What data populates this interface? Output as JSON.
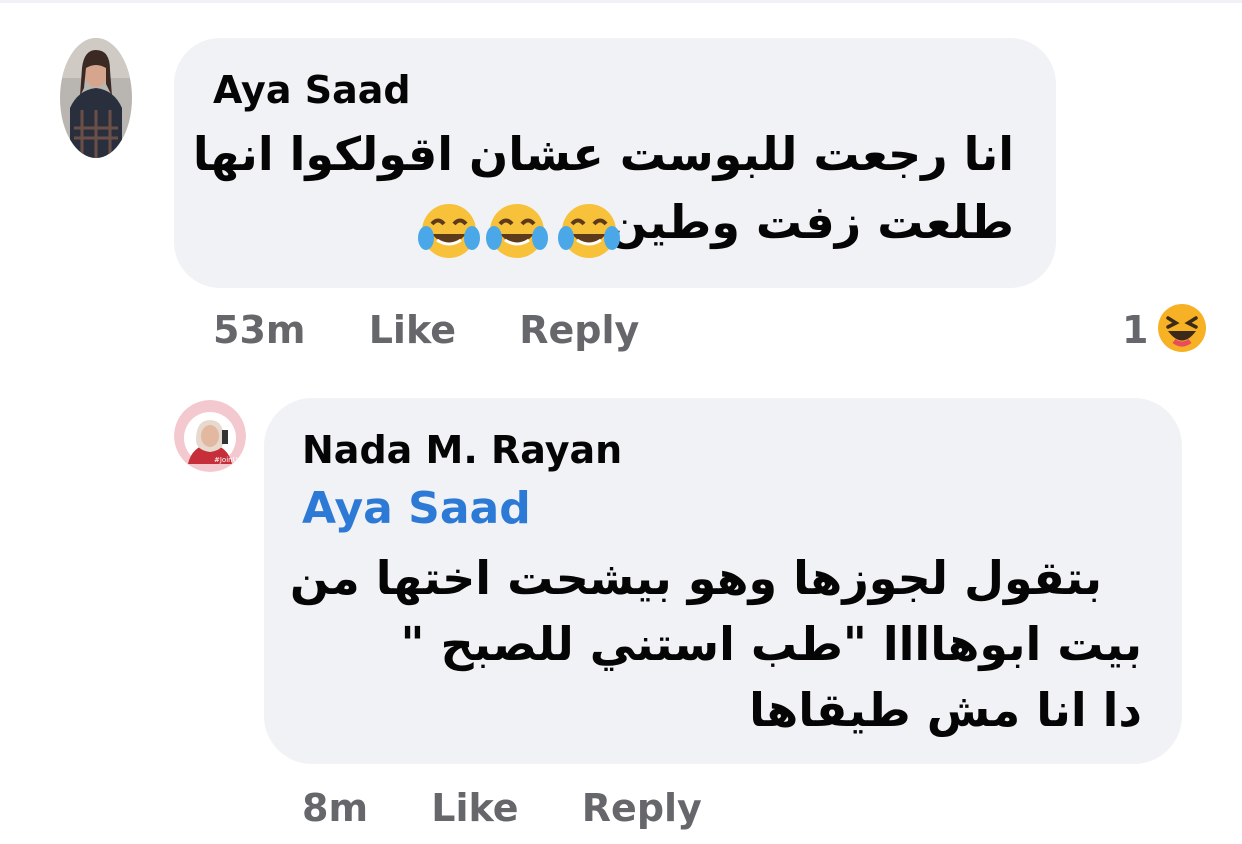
{
  "colors": {
    "bubble_bg": "#f0f2f5",
    "name_text": "#050505",
    "meta_text": "#65676b",
    "mention_link": "#2d7ad6",
    "haha_reaction": "#f7b125"
  },
  "comment": {
    "author": "Aya Saad",
    "text_lines": [
      "انا رجعت للبوست عشان اقولكوا انها",
      "طلعت زفت وطين"
    ],
    "emojis": [
      "face-with-tears-of-joy-icon",
      "face-with-tears-of-joy-icon",
      "face-with-tears-of-joy-icon"
    ],
    "time": "53m",
    "like_label": "Like",
    "reply_label": "Reply",
    "reaction_count": "1",
    "reaction_icon": "laughing-face-icon"
  },
  "reply": {
    "author": "Nada M. Rayan",
    "mention": "Aya Saad",
    "text_lines": [
      "بتقول لجوزها وهو بيشحت اختها من",
      "بيت ابوهاااا \"طب استني للصبح \"",
      "دا انا مش طيقاها"
    ],
    "time": "8m",
    "like_label": "Like",
    "reply_label": "Reply"
  }
}
